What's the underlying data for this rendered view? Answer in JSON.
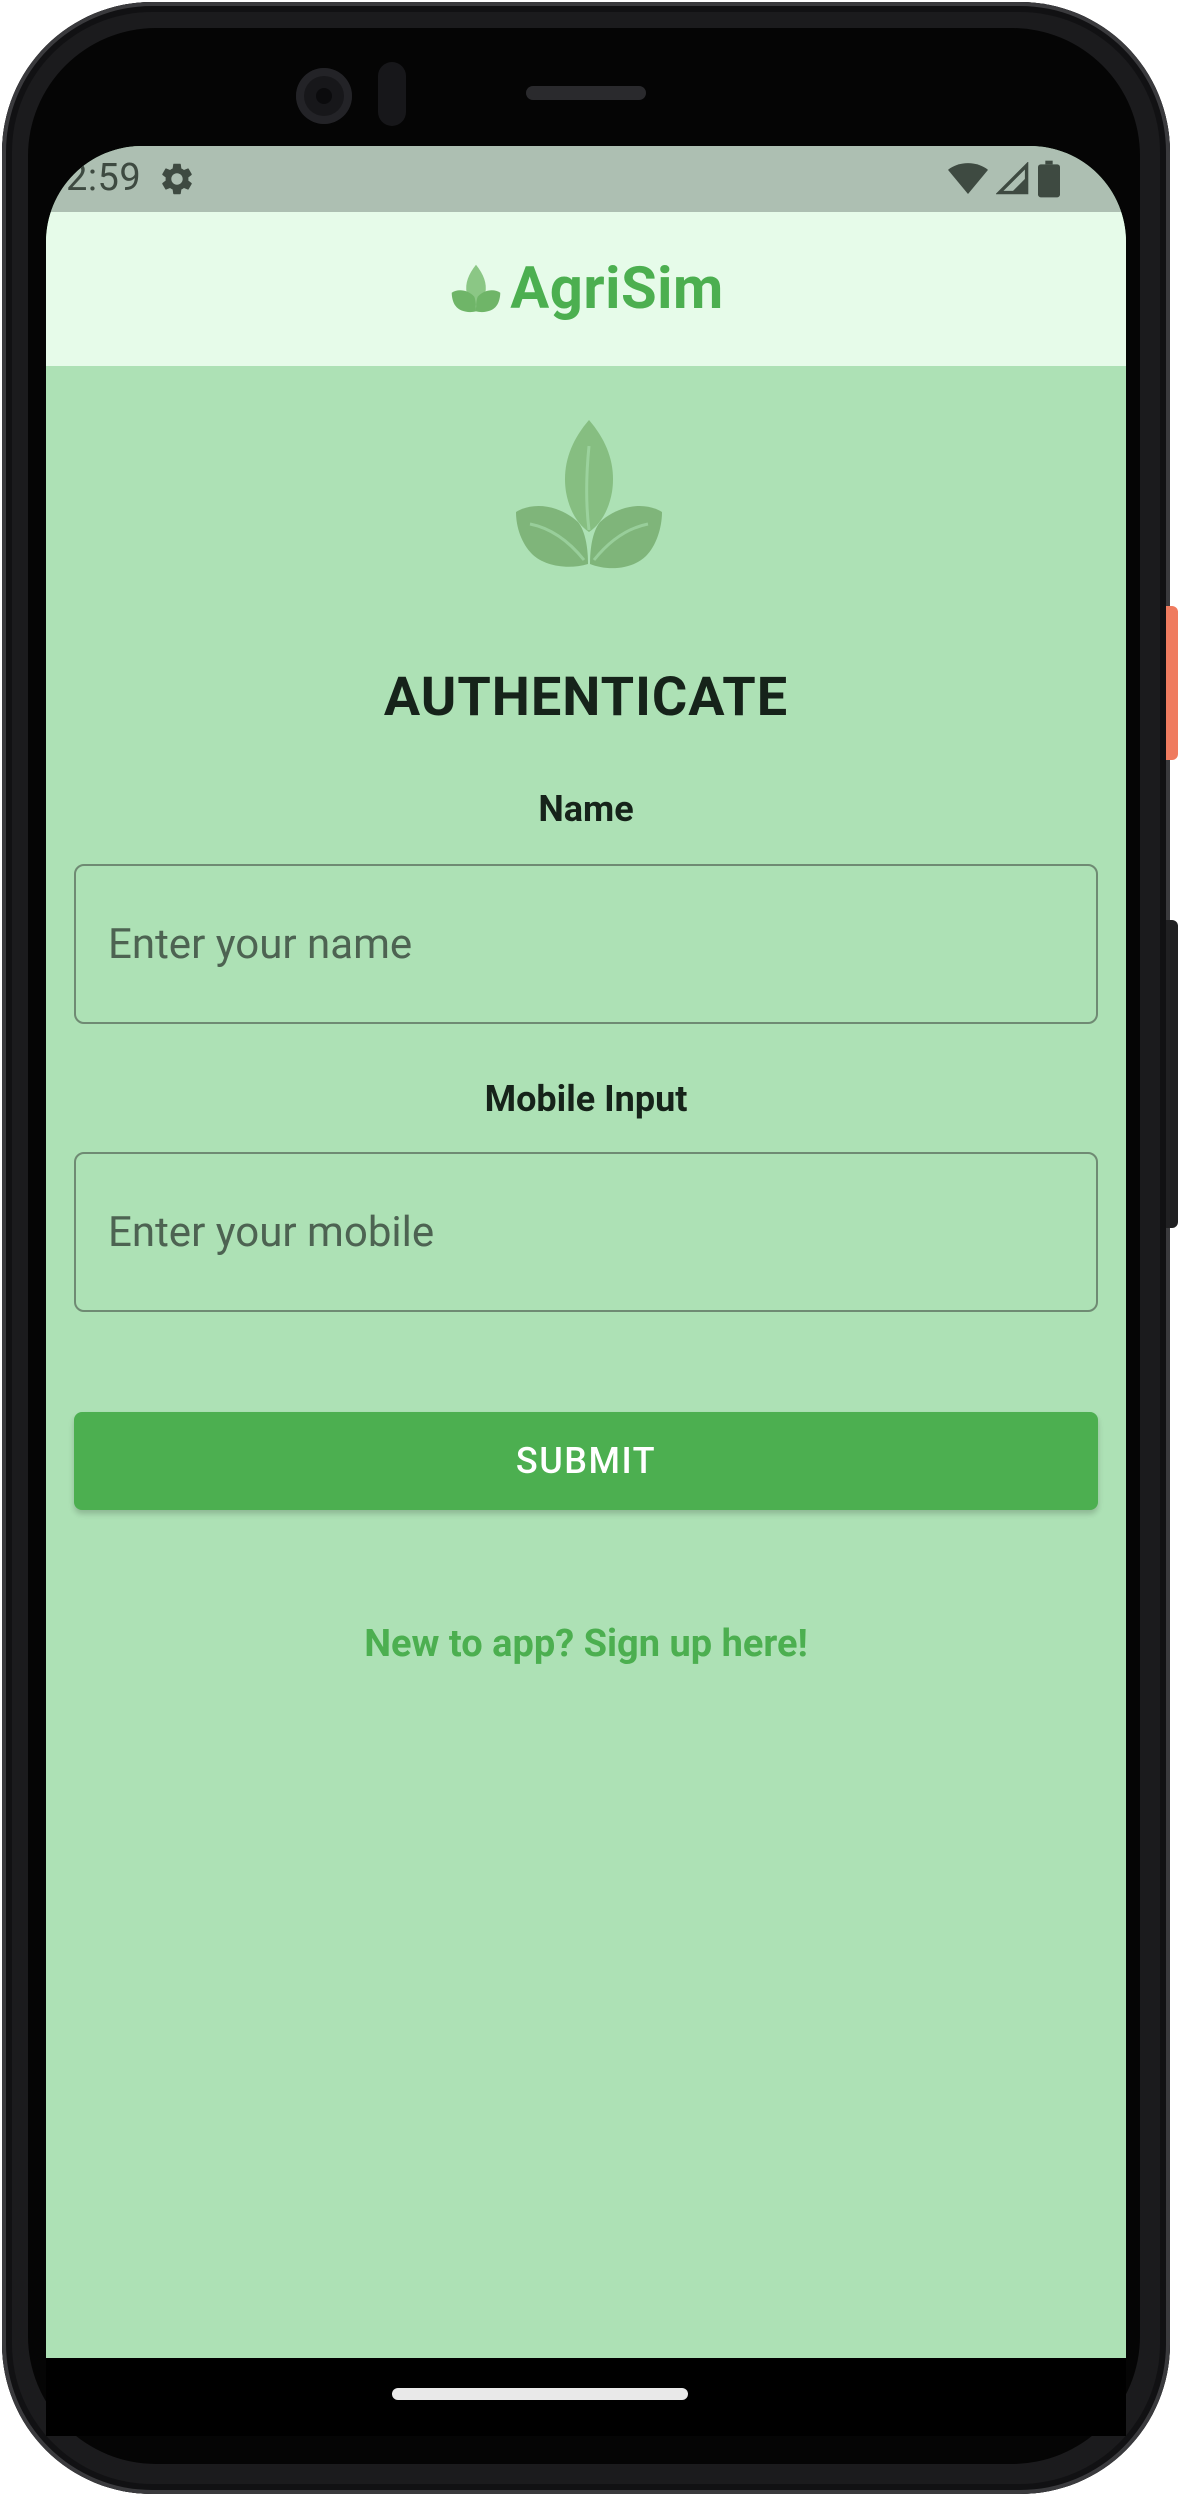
{
  "status_bar": {
    "time": "2:59",
    "icons": [
      "settings-gear-icon",
      "wifi-icon",
      "cell-signal-icon",
      "battery-icon"
    ]
  },
  "app_header": {
    "brand_name": "AgriSim",
    "logo_icon": "leaf-logo-icon"
  },
  "form": {
    "title": "AUTHENTICATE",
    "name_label": "Name",
    "name_placeholder": "Enter your name",
    "name_value": "",
    "mobile_label": "Mobile Input",
    "mobile_placeholder": "Enter your mobile",
    "mobile_value": "",
    "submit_label": "SUBMIT",
    "signup_link": "New to app? Sign up here!"
  },
  "colors": {
    "accent": "#4caf50",
    "background": "#ade1b5",
    "header_background": "#e6fbe9",
    "status_bar": "#adbfb2",
    "logo_muted": "#86be81"
  }
}
